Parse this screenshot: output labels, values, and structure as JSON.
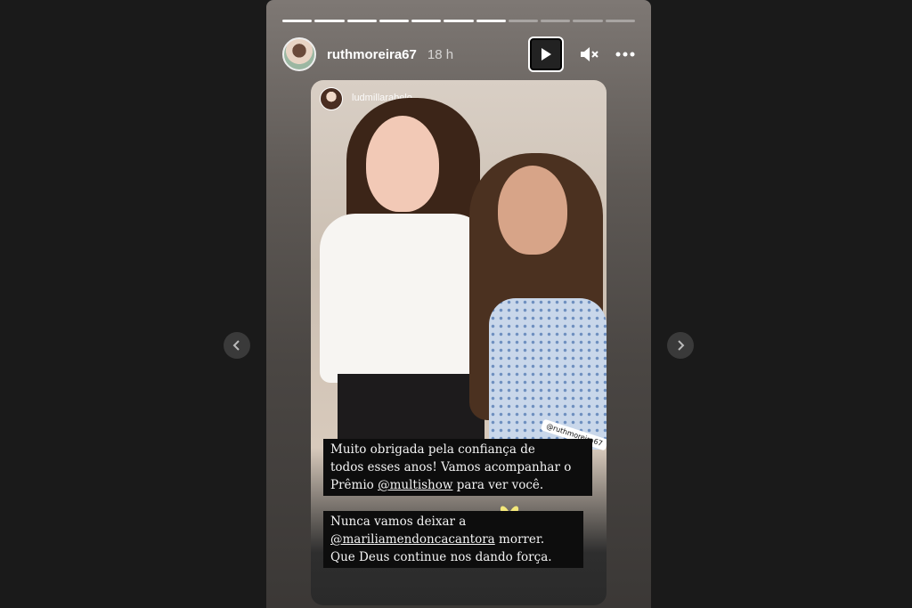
{
  "story": {
    "progress_segments": 11,
    "progress_completed": 7,
    "user": {
      "username": "ruthmoreira67",
      "time": "18 h"
    },
    "controls": {
      "play_icon": "play-icon",
      "mute_icon": "speaker-muted-icon",
      "more_icon": "more-horizontal-icon"
    },
    "repost": {
      "username": "ludmillarabelo"
    },
    "sticker": {
      "mention": "@ruthmoreira67"
    },
    "caption_one": {
      "line1": "Muito obrigada pela confiança de",
      "line2": "todos esses anos! Vamos acompanhar o",
      "line3_pre": "Prêmio ",
      "line3_mention": "@multishow",
      "line3_post": " para ver você."
    },
    "caption_two": {
      "line1": "Nunca vamos deixar a",
      "line2_mention": "@mariliamendoncacantora",
      "line2_post": " morrer.",
      "line3": "Que Deus continue nos dando força."
    }
  },
  "nav": {
    "prev_icon": "chevron-left-icon",
    "next_icon": "chevron-right-icon"
  }
}
